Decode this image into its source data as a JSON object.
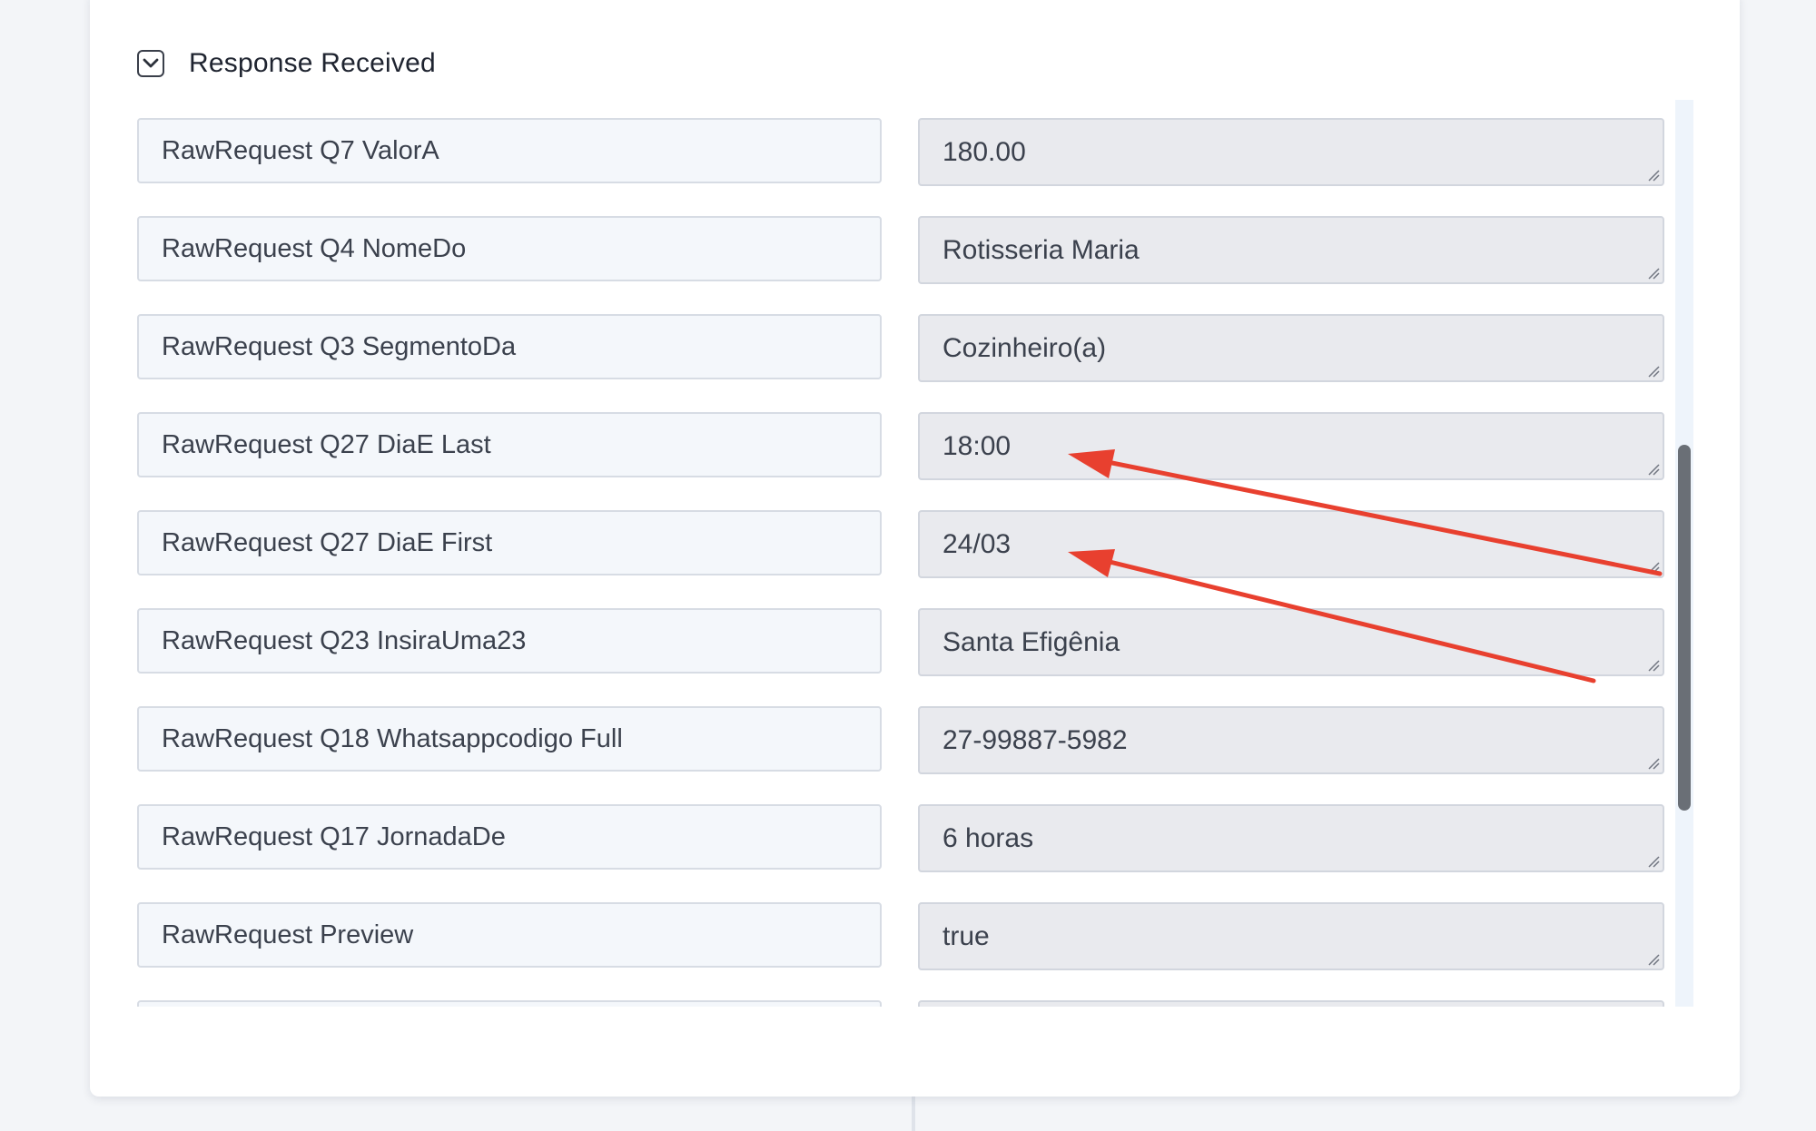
{
  "section": {
    "title": "Response Received",
    "toggle_icon": "chevron-down-icon",
    "expanded": true
  },
  "rows": [
    {
      "key": "RawRequest Q7 ValorA",
      "value": "180.00"
    },
    {
      "key": "RawRequest Q4 NomeDo",
      "value": "Rotisseria Maria"
    },
    {
      "key": "RawRequest Q3 SegmentoDa",
      "value": "Cozinheiro(a)"
    },
    {
      "key": "RawRequest Q27 DiaE Last",
      "value": "18:00"
    },
    {
      "key": "RawRequest Q27 DiaE First",
      "value": "24/03"
    },
    {
      "key": "RawRequest Q23 InsiraUma23",
      "value": "Santa Efigênia"
    },
    {
      "key": "RawRequest Q18 Whatsappcodigo Full",
      "value": "27-99887-5982"
    },
    {
      "key": "RawRequest Q17 JornadaDe",
      "value": "6 horas"
    },
    {
      "key": "RawRequest Preview",
      "value": "true"
    },
    {
      "key": "",
      "value": ""
    }
  ],
  "annotations": {
    "arrow_color": "#e8402f",
    "arrow_count": 2
  },
  "scrollbar": {
    "thumb_color": "#6a6f76",
    "track_color": "#eef4fb"
  }
}
